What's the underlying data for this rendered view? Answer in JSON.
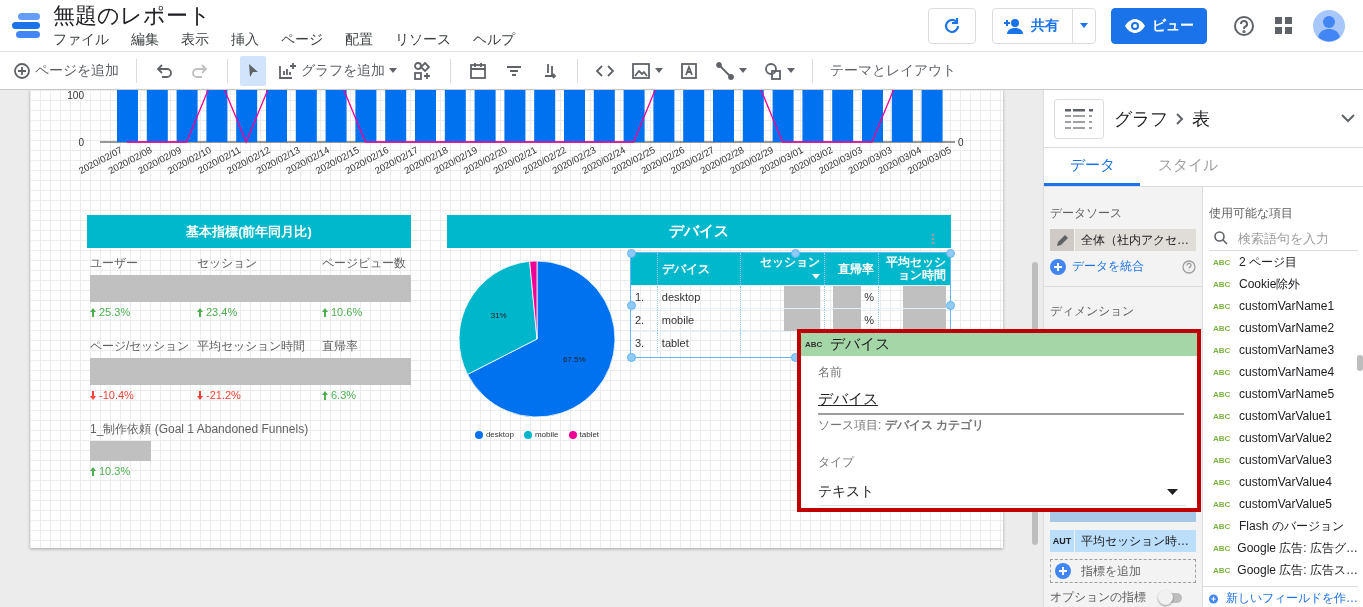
{
  "header": {
    "title": "無題のレポート",
    "menu": [
      "ファイル",
      "編集",
      "表示",
      "挿入",
      "ページ",
      "配置",
      "リソース",
      "ヘルプ"
    ],
    "share_label": "共有",
    "view_label": "ビュー"
  },
  "toolbar": {
    "groups": [
      [
        {
          "kind": "add_page",
          "label": "ページを追加",
          "selected": false,
          "disabled": false
        }
      ],
      [
        {
          "kind": "undo",
          "selected": false,
          "disabled": false
        },
        {
          "kind": "redo",
          "selected": false,
          "disabled": true
        }
      ],
      [
        {
          "kind": "cursor",
          "selected": true,
          "disabled": false
        },
        {
          "kind": "add_chart",
          "label": "グラフを追加",
          "selected": false,
          "disabled": false
        },
        {
          "kind": "component",
          "selected": false,
          "disabled": false
        }
      ],
      [
        {
          "kind": "calendar",
          "selected": false,
          "disabled": false
        },
        {
          "kind": "filter",
          "selected": false,
          "disabled": false
        },
        {
          "kind": "data_control",
          "selected": false,
          "disabled": false
        }
      ],
      [
        {
          "kind": "code",
          "selected": false,
          "disabled": false
        },
        {
          "kind": "image",
          "selected": false,
          "disabled": false
        },
        {
          "kind": "textbox",
          "selected": false,
          "disabled": false
        },
        {
          "kind": "line",
          "selected": false,
          "disabled": false
        },
        {
          "kind": "shape",
          "selected": false,
          "disabled": false
        }
      ],
      [
        {
          "kind": "theme",
          "label": "テーマとレイアウト",
          "selected": false,
          "disabled": false
        }
      ]
    ]
  },
  "timeline": {
    "left_ticks": [
      "100",
      "0"
    ],
    "right_tick": "0",
    "dates": [
      "2020/02/07",
      "2020/02/08",
      "2020/02/09",
      "2020/02/10",
      "2020/02/11",
      "2020/02/12",
      "2020/02/13",
      "2020/02/14",
      "2020/02/15",
      "2020/02/16",
      "2020/02/17",
      "2020/02/18",
      "2020/02/19",
      "2020/02/20",
      "2020/02/21",
      "2020/02/22",
      "2020/02/23",
      "2020/02/24",
      "2020/02/25",
      "2020/02/26",
      "2020/02/27",
      "2020/02/28",
      "2020/02/29",
      "2020/03/01",
      "2020/03/02",
      "2020/03/03",
      "2020/03/03",
      "2020/03/04",
      "2020/03/05"
    ]
  },
  "metrics_card": {
    "title": "基本指標(前年同月比)",
    "rows": [
      [
        {
          "label": "ユーザー",
          "change": "25.3%",
          "increase": true
        },
        {
          "label": "セッション",
          "change": "23.4%",
          "increase": true
        },
        {
          "label": "ページビュー数",
          "change": "10.6%",
          "increase": true
        }
      ],
      [
        {
          "label": "ページ/セッション",
          "change": "-10.4%",
          "increase": false
        },
        {
          "label": "平均セッション時間",
          "change": "-21.2%",
          "increase": false
        },
        {
          "label": "直帰率",
          "change": "6.3%",
          "increase": true
        }
      ],
      [
        {
          "label": "1_制作依頼 (Goal 1 Abandoned Funnels)",
          "change": "10.3%",
          "increase": true
        }
      ]
    ]
  },
  "device_section": {
    "title": "デバイス",
    "chart_data": {
      "type": "pie",
      "categories": [
        "desktop",
        "mobile",
        "tablet"
      ],
      "values": [
        67.5,
        31,
        1.5
      ],
      "colors": [
        "#0072f0",
        "#00b6cb",
        "#f10096"
      ],
      "value_labels": [
        "67.5%",
        "31%",
        null
      ]
    },
    "table": {
      "columns": [
        {
          "label": "デバイス",
          "sorted": false
        },
        {
          "label": "セッション",
          "sorted": true
        },
        {
          "label": "直帰率",
          "sorted": false
        },
        {
          "label": "平均セッション時間",
          "sorted": false
        }
      ],
      "rows": [
        {
          "index": "1.",
          "device": "desktop",
          "redacted": true,
          "bounce_tail": "%"
        },
        {
          "index": "2.",
          "device": "mobile",
          "redacted": true,
          "bounce_tail": "%"
        },
        {
          "index": "3.",
          "device": "tablet",
          "redacted": false
        }
      ]
    }
  },
  "field_popup": {
    "type_badge": "ABC",
    "title": "デバイス",
    "name_label": "名前",
    "name_value": "デバイス",
    "source": "ソース項目: **デバイス カテゴリ**",
    "type_label": "タイプ",
    "type_value": "テキスト"
  },
  "panel": {
    "chart_kind": "グラフ",
    "chart_type": "表",
    "tabs": [
      {
        "label": "データ",
        "selected": true
      },
      {
        "label": "スタイル",
        "selected": false
      }
    ],
    "data_source_label": "データソース",
    "data_source": "全体（社内アクセ…",
    "blend": "データを統合",
    "dimension_label": "ディメンション",
    "metric_chips": [
      {
        "type": "AUT",
        "label": "平均セッション時…"
      }
    ],
    "add_metric": "指標を追加",
    "optional_metrics": "オプションの指標",
    "optional_metrics_on": false,
    "fields_label": "使用可能な項目",
    "search_placeholder": "検索語句を入力",
    "fields": [
      {
        "type": "ABC",
        "name": "2 ページ目"
      },
      {
        "type": "ABC",
        "name": "Cookie除外"
      },
      {
        "type": "ABC",
        "name": "customVarName1"
      },
      {
        "type": "ABC",
        "name": "customVarName2"
      },
      {
        "type": "ABC",
        "name": "customVarName3"
      },
      {
        "type": "ABC",
        "name": "customVarName4"
      },
      {
        "type": "ABC",
        "name": "customVarName5"
      },
      {
        "type": "ABC",
        "name": "customVarValue1"
      },
      {
        "type": "ABC",
        "name": "customVarValue2"
      },
      {
        "type": "ABC",
        "name": "customVarValue3"
      },
      {
        "type": "ABC",
        "name": "customVarValue4"
      },
      {
        "type": "ABC",
        "name": "customVarValue5"
      },
      {
        "type": "ABC",
        "name": "Flash のバージョン"
      },
      {
        "type": "ABC",
        "name": "Google 広告: 広告グ…"
      },
      {
        "type": "ABC",
        "name": "Google 広告: 広告ス…"
      }
    ],
    "create_field": "新しいフィールドを作…"
  }
}
